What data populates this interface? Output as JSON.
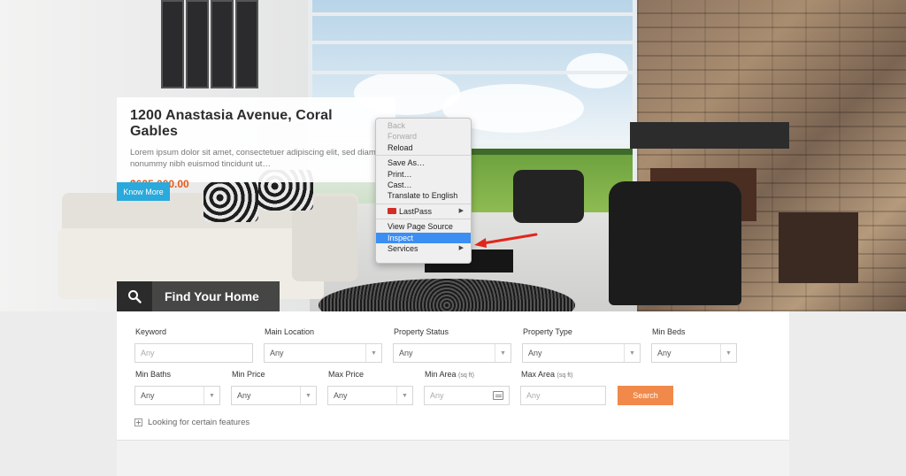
{
  "listing": {
    "title": "1200 Anastasia Avenue, Coral Gables",
    "description": "Lorem ipsum dolor sit amet, consectetuer adipiscing elit, sed diam nonummy nibh euismod tincidunt ut…",
    "price": "$625,000.00",
    "cta_label": "Know More"
  },
  "search_tab": {
    "label": "Find Your Home",
    "icon": "search-icon"
  },
  "context_menu": {
    "items": {
      "back": "Back",
      "forward": "Forward",
      "reload": "Reload",
      "save_as": "Save As…",
      "print": "Print…",
      "cast": "Cast…",
      "translate": "Translate to English",
      "lastpass": "LastPass",
      "view_source": "View Page Source",
      "inspect": "Inspect",
      "services": "Services"
    },
    "highlighted": "Inspect"
  },
  "search_form": {
    "keyword_label": "Keyword",
    "keyword_placeholder": "Any",
    "location_label": "Main Location",
    "location_value": "Any",
    "status_label": "Property Status",
    "status_value": "Any",
    "type_label": "Property Type",
    "type_value": "Any",
    "beds_label": "Min Beds",
    "beds_value": "Any",
    "baths_label": "Min Baths",
    "baths_value": "Any",
    "min_price_label": "Min Price",
    "min_price_value": "Any",
    "max_price_label": "Max Price",
    "max_price_value": "Any",
    "min_area_label": "Min Area",
    "min_area_unit": "(sq ft)",
    "min_area_placeholder": "Any",
    "max_area_label": "Max Area",
    "max_area_unit": "(sq ft)",
    "max_area_placeholder": "Any",
    "search_label": "Search",
    "features_label": "Looking for certain features"
  },
  "colors": {
    "price": "#e35a1a",
    "cta": "#29a9dc",
    "search_button": "#f0894a",
    "menu_highlight": "#3b8ef2",
    "arrow": "#e0261c"
  }
}
